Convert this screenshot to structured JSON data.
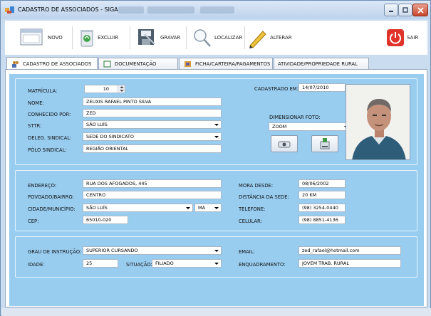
{
  "window": {
    "title": "CADASTRO DE ASSOCIADOS - SIGA",
    "controls": [
      "minimize",
      "maximize",
      "close"
    ]
  },
  "toolbar": {
    "novo": "NOVO",
    "excluir": "EXCLUIR",
    "gravar": "GRAVAR",
    "localizar": "LOCALIZAR",
    "alterar": "ALTERAR",
    "sair": "SAIR"
  },
  "tabs": [
    {
      "label": "CADASTRO DE ASSOCIADOS"
    },
    {
      "label": "DOCUMENTAÇÃO"
    },
    {
      "label": "FICHA/CARTEIRA/PAGAMENTOS"
    },
    {
      "label": "ATIVIDADE/PROPRIEDADE RURAL"
    }
  ],
  "section1": {
    "matricula_label": "MATRÍCULA:",
    "matricula": "10",
    "nome_label": "NOME:",
    "nome": "ZEUXIS RAFAEL PINTO SILVA",
    "conhecido_label": "CONHECIDO POR:",
    "conhecido": "ZED",
    "sttr_label": "STTR:",
    "sttr": "SÃO LUÍS",
    "deleg_label": "DELEG. SINDICAL:",
    "deleg": "SEDE DO SINDICATO",
    "polo_label": "PÓLO SINDICAL:",
    "polo": "REGIÃO ORIENTAL",
    "cadastrado_label": "CADASTRADO EM:",
    "cadastrado": "14/07/2010",
    "dimensionar_label": "DIMENSIONAR FOTO:",
    "dimensionar": "ZOOM"
  },
  "section2": {
    "endereco_label": "ENDEREÇO:",
    "endereco": "RUA DOS AFOGADOS, 445",
    "povoado_label": "POVOADO/BAIRRO:",
    "povoado": "CENTRO",
    "cidade_label": "CIDADE/MUNICÍPIO:",
    "cidade": "SÃO LUÍS",
    "uf": "MA",
    "cep_label": "CEP:",
    "cep": "65010-020",
    "mora_label": "MORA DESDE:",
    "mora": "08/06/2002",
    "distancia_label": "DISTÂNCIA DA SEDE:",
    "distancia": "20 KM",
    "telefone_label": "TELEFONE:",
    "telefone": "(98) 3254-0440",
    "celular_label": "CELULAR:",
    "celular": "(98) 8851-4136"
  },
  "section3": {
    "grau_label": "GRAU DE INSTRUÇÃO:",
    "grau": "SUPERIOR CURSANDO",
    "idade_label": "IDADE:",
    "idade": "25",
    "situacao_label": "SITUAÇÃO:",
    "situacao": "FILIADO",
    "email_label": "EMAIL:",
    "email": "zed_rafael@hotmail.com",
    "enquadramento_label": "ENQUADRAMENTO:",
    "enquadramento": "JOVEM TRAB. RURAL"
  },
  "icons": [
    "app-icon",
    "new-document-icon",
    "recycle-bin-icon",
    "save-icon",
    "magnifier-icon",
    "pencil-icon",
    "power-icon",
    "camera-icon",
    "scanner-icon"
  ],
  "colors": {
    "panel": "#99cdf0",
    "close": "#c9452c",
    "exit": "#e0332a"
  }
}
